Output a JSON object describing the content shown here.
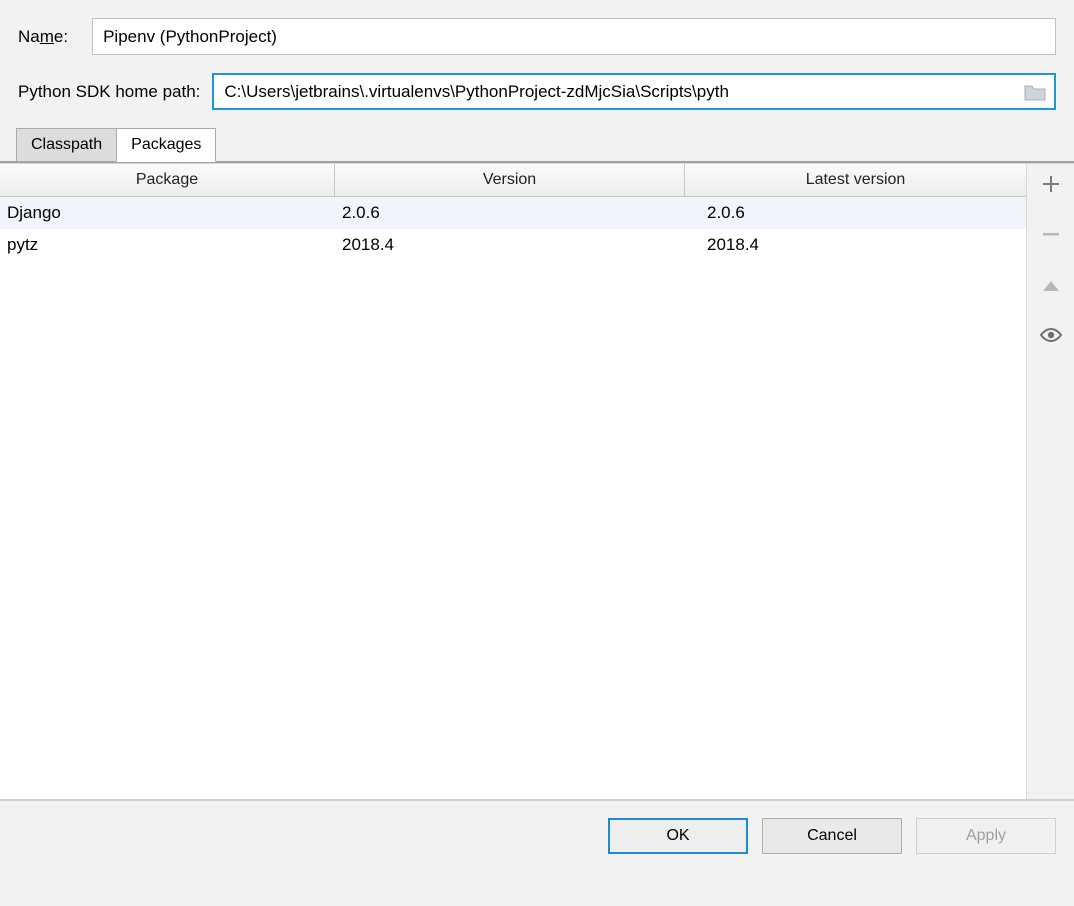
{
  "form": {
    "name_label_pre": "Na",
    "name_label_u": "m",
    "name_label_post": "e:",
    "name_value": "Pipenv (PythonProject)",
    "path_label": "Python SDK home path:",
    "path_value": "C:\\Users\\jetbrains\\.virtualenvs\\PythonProject-zdMjcSia\\Scripts\\pyth"
  },
  "tabs": {
    "classpath": "Classpath",
    "packages": "Packages"
  },
  "table": {
    "headers": {
      "pkg": "Package",
      "ver": "Version",
      "lat": "Latest version"
    },
    "rows": [
      {
        "pkg": "Django",
        "ver": "2.0.6",
        "lat": "2.0.6"
      },
      {
        "pkg": "pytz",
        "ver": "2018.4",
        "lat": "2018.4"
      }
    ]
  },
  "buttons": {
    "ok": "OK",
    "cancel": "Cancel",
    "apply": "Apply"
  }
}
